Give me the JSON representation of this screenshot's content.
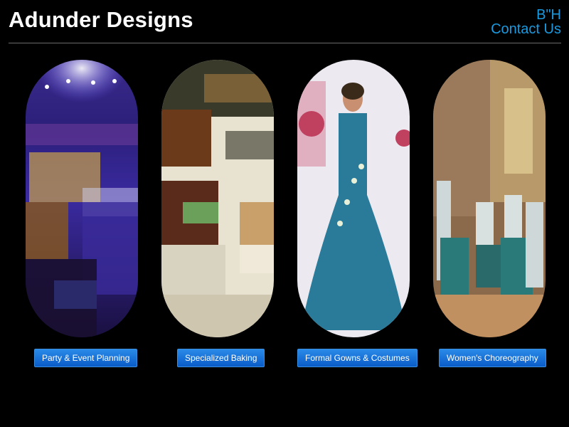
{
  "header": {
    "site_title": "Adunder Designs",
    "bh": "B\"H",
    "contact_label": "Contact Us"
  },
  "colors": {
    "background": "#000000",
    "link": "#1a9ae0",
    "button": "#0a5cc8"
  },
  "cards": [
    {
      "label": "Party & Event Planning",
      "image": "banquet-hall-photo"
    },
    {
      "label": "Specialized Baking",
      "image": "pastry-display-photo"
    },
    {
      "label": "Formal Gowns & Costumes",
      "image": "blue-gown-photo"
    },
    {
      "label": "Women's Choreography",
      "image": "dance-stage-photo"
    }
  ]
}
